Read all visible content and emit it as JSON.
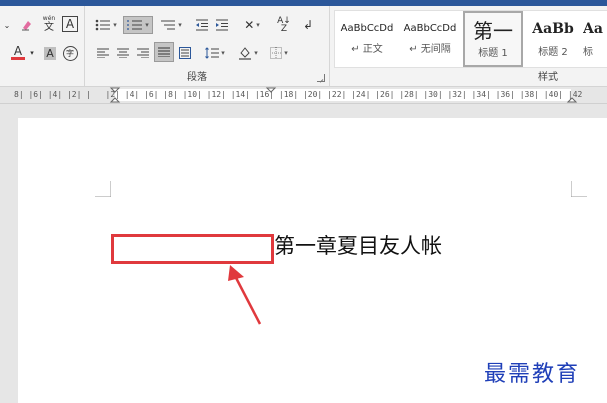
{
  "ribbon": {
    "font_group": {
      "font_color_letter": "A",
      "highlight_letter": "A",
      "char_border_letter": "A",
      "phonetic_top": "wén",
      "phonetic_char": "文",
      "enclose_char": "字",
      "font_color_accent": "#e0393d"
    },
    "paragraph_group": {
      "label": "段落"
    },
    "styles_group": {
      "label": "样式",
      "items": [
        {
          "preview": "AaBbCcDd",
          "name": "↵ 正文"
        },
        {
          "preview": "AaBbCcDd",
          "name": "↵ 无间隔"
        },
        {
          "preview": "第一",
          "name": "标题 1"
        },
        {
          "preview": "AaBb",
          "name": "标题 2"
        },
        {
          "preview": "Aa",
          "name": "标"
        }
      ]
    }
  },
  "ruler": {
    "numbers": "8| |6| |4| |2| |   |2| |4| |6| |8| |10| |12| |14| |16| |18| |20| |22| |24| |26| |28| |30| |32| |34| |36| |38| |40| |42"
  },
  "document": {
    "heading": "第一章夏目友人帐",
    "annotation_color": "#e0393d"
  },
  "watermark": {
    "text": "最需教育",
    "color": "#1f3fb8"
  }
}
